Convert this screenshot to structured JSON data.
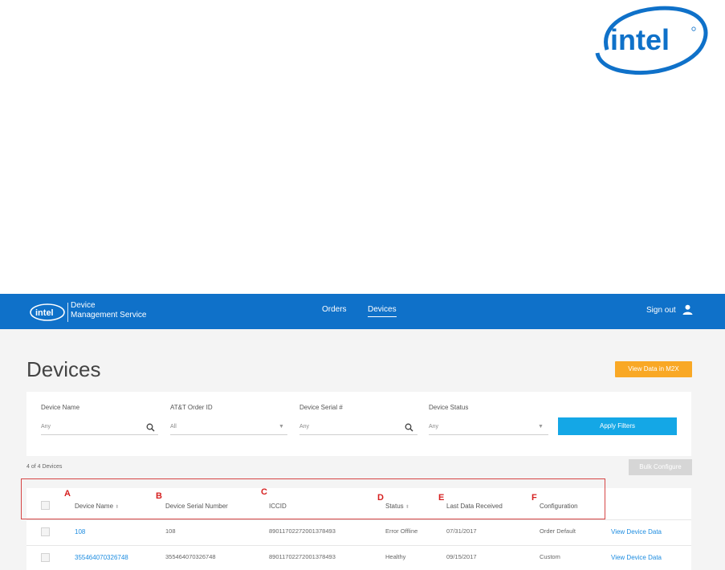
{
  "logo": {
    "text": "intel",
    "color": "#0f71c9"
  },
  "navbar": {
    "brand_line1": "Device",
    "brand_line2": "Management Service",
    "links": [
      "Orders",
      "Devices"
    ],
    "active_link": "Devices",
    "sign_out": "Sign out",
    "background": "#0f71c9"
  },
  "page": {
    "title": "Devices",
    "view_data_button": "View Data in M2X",
    "apply_filters_button": "Apply Filters",
    "bulk_configure_button": "Bulk Configure",
    "device_count": "4 of 4 Devices"
  },
  "filters": [
    {
      "label": "Device Name",
      "value": "Any",
      "kind": "search"
    },
    {
      "label": "AT&T Order ID",
      "value": "All",
      "kind": "select"
    },
    {
      "label": "Device Serial #",
      "value": "Any",
      "kind": "search"
    },
    {
      "label": "Device Status",
      "value": "Any",
      "kind": "select"
    }
  ],
  "table": {
    "columns": [
      "Device Name",
      "Device Serial Number",
      "ICCID",
      "Status",
      "Last Data Received",
      "Configuration"
    ],
    "rows": [
      {
        "name": "108",
        "serial": "108",
        "iccid": "89011702272001378493",
        "status": "Error Offline",
        "last": "07/31/2017",
        "config": "Order Default",
        "action": "View Device Data"
      },
      {
        "name": "355464070326748",
        "serial": "355464070326748",
        "iccid": "89011702272001378493",
        "status": "Healthy",
        "last": "09/15/2017",
        "config": "Custom",
        "action": "View Device Data"
      }
    ]
  },
  "annotations": [
    "A",
    "B",
    "C",
    "D",
    "E",
    "F"
  ],
  "colors": {
    "accent": "#0f71c9",
    "orange": "#f9a825",
    "apply": "#14a7e6",
    "annotation": "#d62020"
  }
}
